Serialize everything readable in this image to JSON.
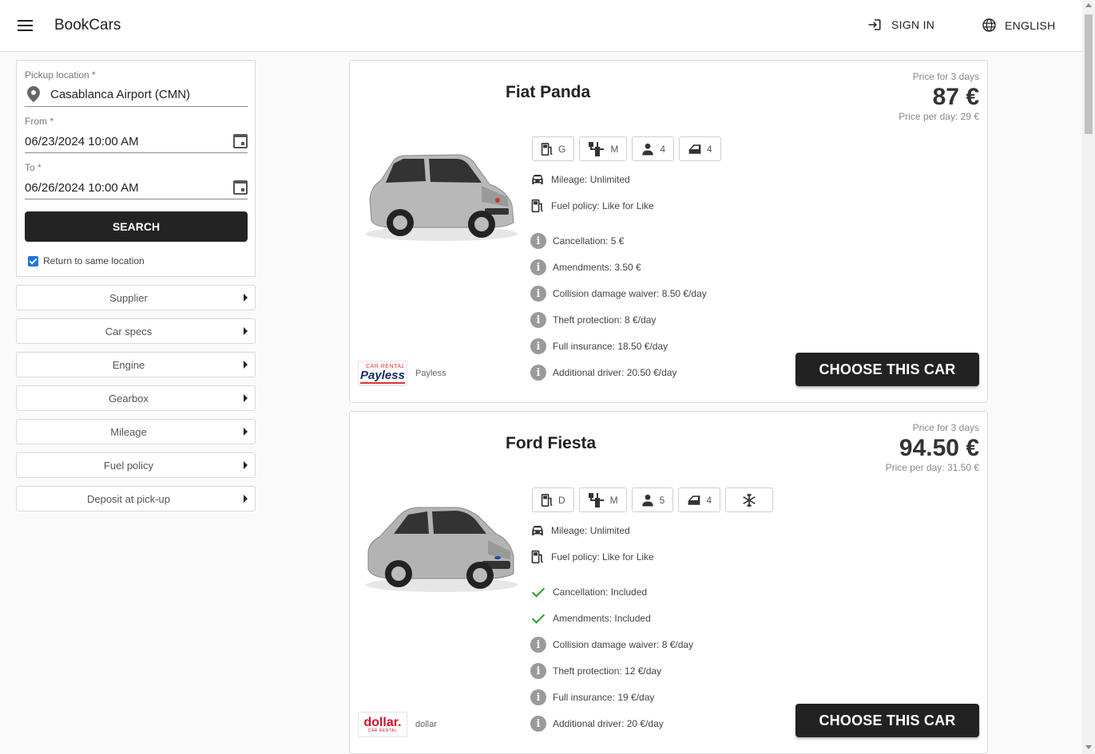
{
  "header": {
    "brand": "BookCars",
    "sign_in": "SIGN IN",
    "language": "ENGLISH"
  },
  "search": {
    "pickup_label": "Pickup location *",
    "pickup_value": "Casablanca Airport (CMN)",
    "from_label": "From *",
    "from_value": "06/23/2024 10:00 AM",
    "to_label": "To *",
    "to_value": "06/26/2024 10:00 AM",
    "button": "SEARCH",
    "same_location": "Return to same location",
    "same_location_checked": true
  },
  "filters": [
    "Supplier",
    "Car specs",
    "Engine",
    "Gearbox",
    "Mileage",
    "Fuel policy",
    "Deposit at pick-up"
  ],
  "cars": [
    {
      "name": "Fiat Panda",
      "price_label": "Price for 3 days",
      "price_total": "87 €",
      "price_day": "Price per day: 29 €",
      "specs": {
        "fuel": "G",
        "gearbox": "M",
        "seats": "4",
        "doors": "4"
      },
      "mileage": "Mileage: Unlimited",
      "fuel_policy": "Fuel policy: Like for Like",
      "extras": [
        {
          "text": "Cancellation: 5 €",
          "included": false
        },
        {
          "text": "Amendments: 3.50 €",
          "included": false
        },
        {
          "text": "Collision damage waiver: 8.50 €/day",
          "included": false
        },
        {
          "text": "Theft protection: 8 €/day",
          "included": false
        },
        {
          "text": "Full insurance: 18.50 €/day",
          "included": false
        },
        {
          "text": "Additional driver: 20.50 €/day",
          "included": false
        }
      ],
      "supplier": "Payless",
      "logo_text": "Payless",
      "logo_sub": "CAR RENTAL",
      "logo_color": "#1b2a6b",
      "car_color": "#b8b8b8",
      "button": "CHOOSE THIS CAR"
    },
    {
      "name": "Ford Fiesta",
      "price_label": "Price for 3 days",
      "price_total": "94.50 €",
      "price_day": "Price per day: 31.50 €",
      "specs": {
        "fuel": "D",
        "gearbox": "M",
        "seats": "5",
        "doors": "4",
        "aircon": true
      },
      "mileage": "Mileage: Unlimited",
      "fuel_policy": "Fuel policy: Like for Like",
      "extras": [
        {
          "text": "Cancellation: Included",
          "included": true
        },
        {
          "text": "Amendments: Included",
          "included": true
        },
        {
          "text": "Collision damage waiver: 8 €/day",
          "included": false
        },
        {
          "text": "Theft protection: 12 €/day",
          "included": false
        },
        {
          "text": "Full insurance: 19 €/day",
          "included": false
        },
        {
          "text": "Additional driver: 20 €/day",
          "included": false
        }
      ],
      "supplier": "dollar",
      "logo_text": "dollar.",
      "logo_sub": "CAR RENTAL",
      "logo_color": "#d3102a",
      "car_color": "#b3b3b3",
      "button": "CHOOSE THIS CAR"
    }
  ]
}
